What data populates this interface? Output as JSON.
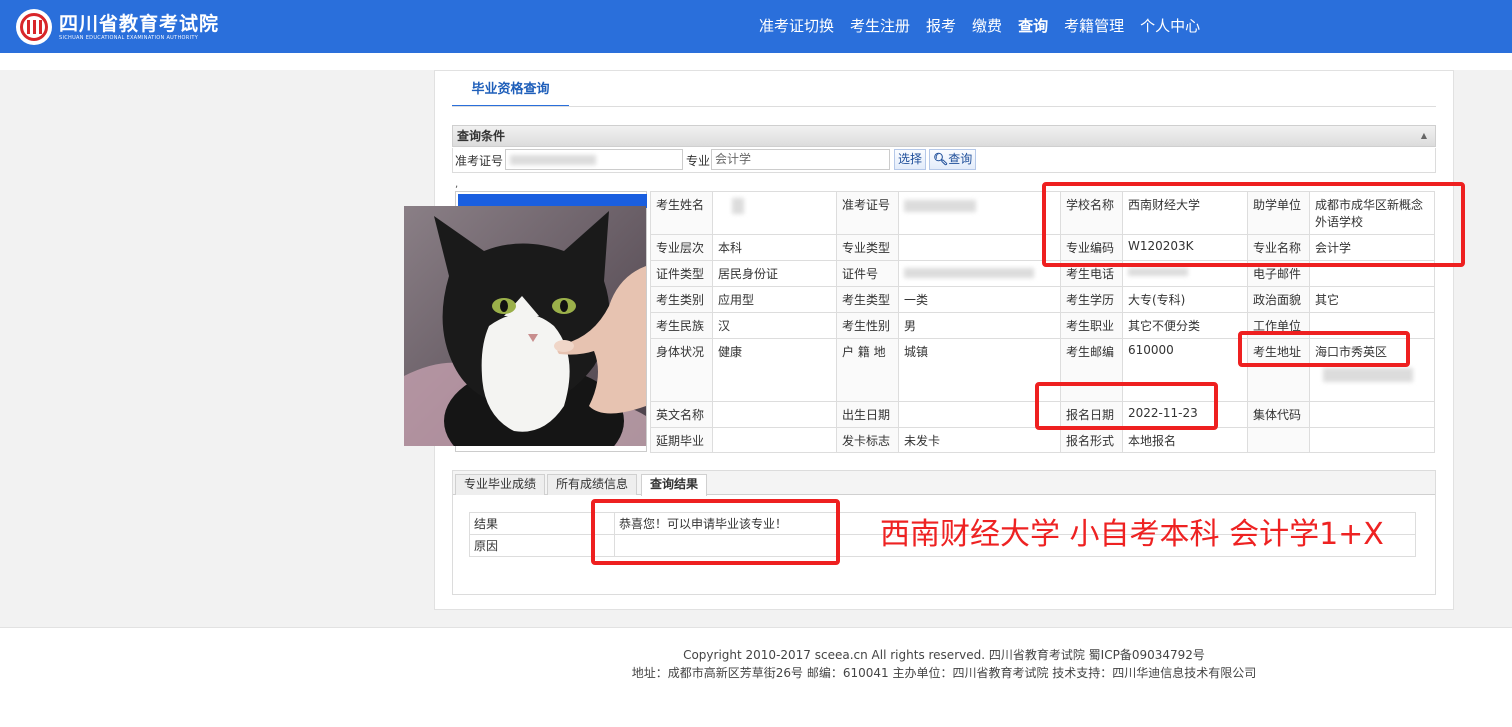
{
  "header": {
    "logo_cn": "四川省教育考试院",
    "logo_en": "SICHUAN EDUCATIONAL EXAMINATION AUTHORITY",
    "nav": [
      "准考证切换",
      "考生注册",
      "报考",
      "缴费",
      "查询",
      "考籍管理",
      "个人中心"
    ]
  },
  "tabs": {
    "main": "毕业资格查询"
  },
  "query": {
    "title": "查询条件",
    "admit_label": "准考证号",
    "major_label": "专业",
    "major_value": "会计学",
    "select_btn": "选择",
    "search_btn": "查询"
  },
  "info": {
    "r1": [
      "考生姓名",
      "",
      "准考证号",
      "",
      "学校名称",
      "西南财经大学",
      "助学单位",
      "成都市成华区新概念外语学校"
    ],
    "r2": [
      "专业层次",
      "本科",
      "专业类型",
      "",
      "专业编码",
      "W120203K",
      "专业名称",
      "会计学"
    ],
    "r3": [
      "证件类型",
      "居民身份证",
      "证件号",
      "",
      "考生电话",
      "",
      "电子邮件",
      ""
    ],
    "r4": [
      "考生类别",
      "应用型",
      "考生类型",
      "一类",
      "考生学历",
      "大专(专科)",
      "政治面貌",
      "其它"
    ],
    "r5": [
      "考生民族",
      "汉",
      "考生性别",
      "男",
      "考生职业",
      "其它不便分类",
      "工作单位",
      ""
    ],
    "r6": [
      "身体状况",
      "健康",
      "户 籍 地",
      "城镇",
      "考生邮编",
      "610000",
      "考生地址",
      "海口市秀英区"
    ],
    "r7": [
      "英文名称",
      "",
      "出生日期",
      "",
      "报名日期",
      "2022-11-23",
      "集体代码",
      ""
    ],
    "r8": [
      "延期毕业",
      "",
      "发卡标志",
      "未发卡",
      "报名形式",
      "本地报名",
      "",
      ""
    ]
  },
  "bottom_tabs": [
    "专业毕业成绩",
    "所有成绩信息",
    "查询结果"
  ],
  "result": {
    "label_result": "结果",
    "value_result": "恭喜您！可以申请毕业该专业！",
    "label_reason": "原因",
    "value_reason": ""
  },
  "overlay_text": "西南财经大学 小自考本科 会计学1+X",
  "footer": {
    "line1": "Copyright 2010-2017 sceea.cn All rights reserved. 四川省教育考试院 蜀ICP备09034792号",
    "line2": "地址：成都市高新区芳草街26号 邮编：610041 主办单位：四川省教育考试院 技术支持：四川华迪信息技术有限公司"
  }
}
